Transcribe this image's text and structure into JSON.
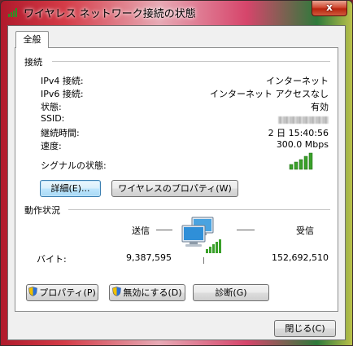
{
  "window": {
    "title": "ワイヤレス ネットワーク接続の状態",
    "close_glyph": "x"
  },
  "tabs": [
    {
      "label": "全般"
    }
  ],
  "connection": {
    "heading": "接続",
    "rows": [
      {
        "label": "IPv4 接続:",
        "value": "インターネット"
      },
      {
        "label": "IPv6 接続:",
        "value": "インターネット アクセスなし"
      },
      {
        "label": "状態:",
        "value": "有効"
      },
      {
        "label": "SSID:",
        "value": ""
      },
      {
        "label": "継続時間:",
        "value": "2 日 15:40:56"
      },
      {
        "label": "速度:",
        "value": "300.0 Mbps"
      }
    ],
    "signal_label": "シグナルの状態:",
    "signal_bars": 5,
    "details_button": "詳細(E)...",
    "wireless_props_button": "ワイヤレスのプロパティ(W)"
  },
  "activity": {
    "heading": "動作状況",
    "sent_label": "送信",
    "received_label": "受信",
    "bytes_label": "バイト:",
    "bytes_sent": "9,387,595",
    "bytes_received": "152,692,510"
  },
  "actions": {
    "properties_button": "プロパティ(P)",
    "disable_button": "無効にする(D)",
    "diagnose_button": "診断(G)"
  },
  "footer": {
    "close_button": "閉じる(C)"
  },
  "colors": {
    "signal_green": "#3aa02a",
    "focus_border": "#3c7fb1",
    "close_red": "#c42b1c"
  }
}
